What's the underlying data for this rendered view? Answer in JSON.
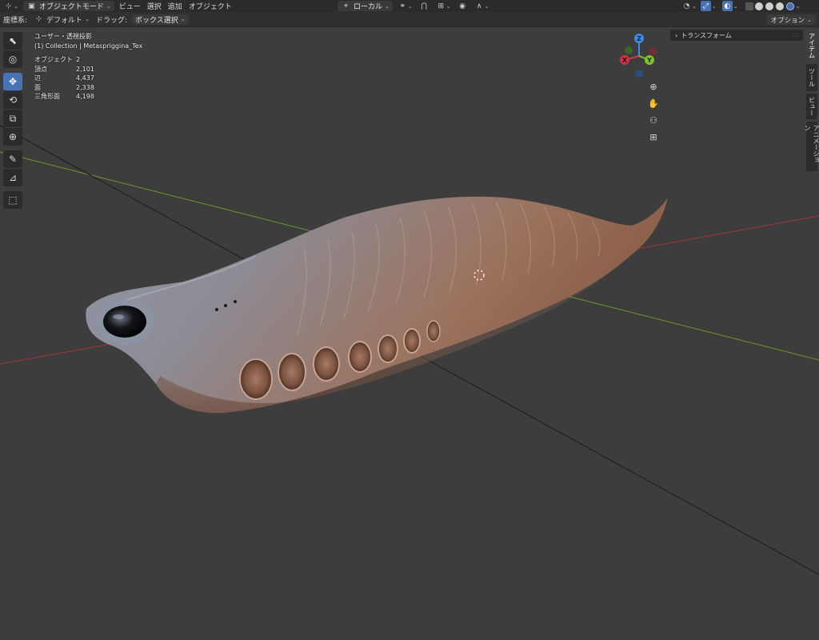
{
  "header": {
    "mode_label": "オブジェクトモード",
    "menus": [
      "ビュー",
      "選択",
      "追加",
      "オブジェクト"
    ],
    "transform_orientation": "ローカル"
  },
  "header2": {
    "coord_label": "座標系:",
    "coord_value": "デフォルト",
    "drag_label": "ドラッグ:",
    "drag_value": "ボックス選択",
    "options_label": "オプション"
  },
  "overlay": {
    "view_name": "ユーザー・透視投影",
    "collection_line": "(1) Collection | Metaspriggina_Tex",
    "stats": [
      {
        "label": "オブジェクト",
        "value": "2"
      },
      {
        "label": "頂点",
        "value": "2,101"
      },
      {
        "label": "辺",
        "value": "4,437"
      },
      {
        "label": "面",
        "value": "2,338"
      },
      {
        "label": "三角形面",
        "value": "4,198"
      }
    ]
  },
  "gizmo": {
    "x": "X",
    "y": "Y",
    "z": "Z"
  },
  "npanel": {
    "transform_header": "トランスフォーム",
    "tabs": [
      "アイテム",
      "ツール",
      "ビュー",
      "アニメーション"
    ]
  },
  "colors": {
    "accent": "#4772b3",
    "axis_x": "#d03346",
    "axis_y": "#7ec12a",
    "axis_z": "#3a8ee6"
  }
}
